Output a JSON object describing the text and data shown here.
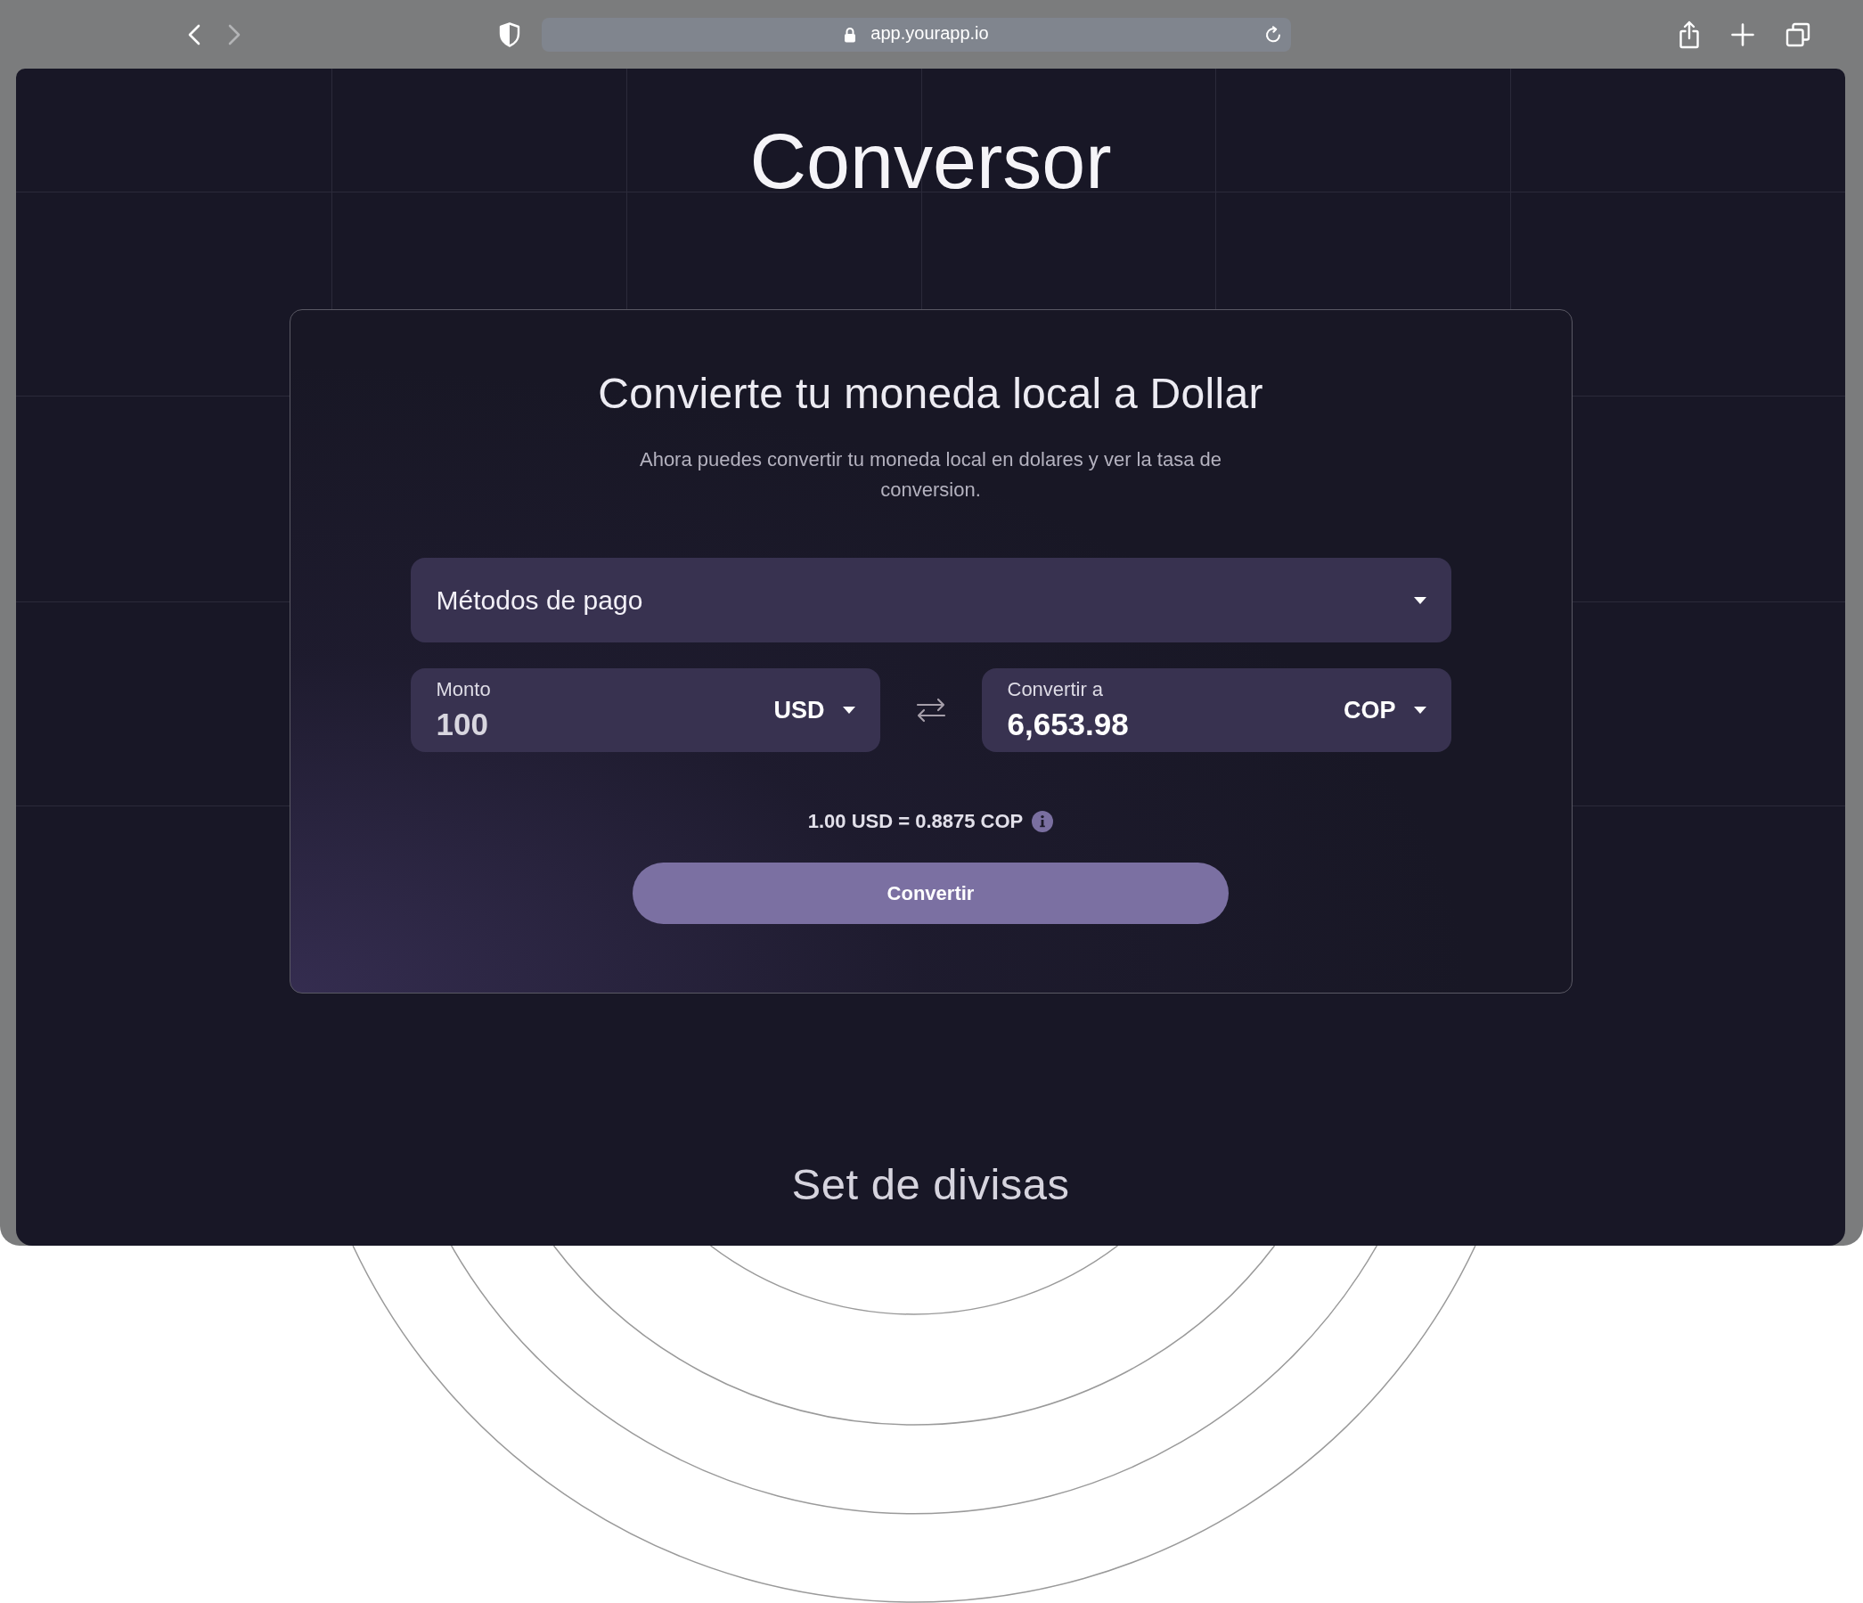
{
  "browser": {
    "url": "app.yourapp.io",
    "back_disabled": false,
    "forward_disabled": true
  },
  "title": "Conversor",
  "converter": {
    "heading": "Convierte tu moneda local a Dollar",
    "description": "Ahora puedes convertir tu moneda local en dolares y ver la tasa de conversion.",
    "payment_select": {
      "label": "Métodos de pago"
    },
    "fields": [
      {
        "kind": "input",
        "label": "Monto",
        "value": "100",
        "currency": "USD"
      },
      {
        "kind": "result",
        "label": "Convertir a",
        "value": "6,653.98",
        "currency": "COP"
      }
    ],
    "rate": "1.00 USD = 0.8875 COP",
    "button": "Convertir"
  },
  "section_title": "Set de divisas"
}
